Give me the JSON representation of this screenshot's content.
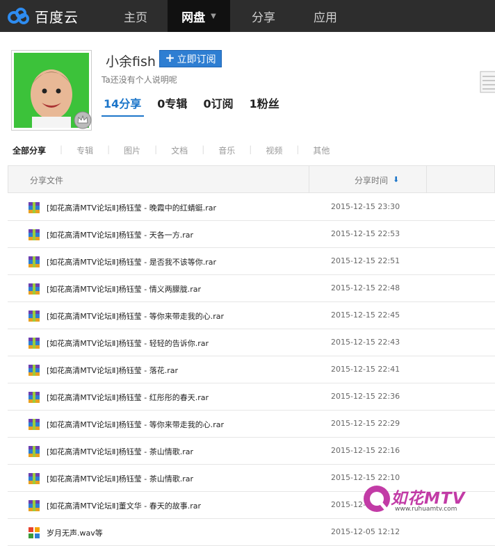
{
  "topbar": {
    "logo_text": "百度云",
    "nav": [
      {
        "label": "主页"
      },
      {
        "label": "网盘"
      },
      {
        "label": "分享"
      },
      {
        "label": "应用"
      }
    ]
  },
  "profile": {
    "username": "小余fish",
    "subscribe_label": "立即订阅",
    "bio": "Ta还没有个人说明呢",
    "stats": [
      {
        "count": "14",
        "label": "分享"
      },
      {
        "count": "0",
        "label": "专辑"
      },
      {
        "count": "0",
        "label": "订阅"
      },
      {
        "count": "1",
        "label": "粉丝"
      }
    ]
  },
  "filters": [
    "全部分享",
    "专辑",
    "图片",
    "文档",
    "音乐",
    "视频",
    "其他"
  ],
  "table": {
    "col_file": "分享文件",
    "col_time": "分享时间",
    "rows": [
      {
        "name": "[如花高清MTV论坛Ⅱ]杨钰莹 - 晚霞中的红蜻蜓.rar",
        "time": "2015-12-15 23:30"
      },
      {
        "name": "[如花高清MTV论坛Ⅱ]杨钰莹 - 天各一方.rar",
        "time": "2015-12-15 22:53"
      },
      {
        "name": "[如花高清MTV论坛Ⅱ]杨钰莹 - 是否我不该等你.rar",
        "time": "2015-12-15 22:51"
      },
      {
        "name": "[如花高清MTV论坛Ⅱ]杨钰莹 - 情义两朦胧.rar",
        "time": "2015-12-15 22:48"
      },
      {
        "name": "[如花高清MTV论坛Ⅱ]杨钰莹 - 等你来带走我的心.rar",
        "time": "2015-12-15 22:45"
      },
      {
        "name": "[如花高清MTV论坛Ⅱ]杨钰莹 - 轻轻的告诉你.rar",
        "time": "2015-12-15 22:43"
      },
      {
        "name": "[如花高清MTV论坛Ⅱ]杨钰莹 - 落花.rar",
        "time": "2015-12-15 22:41"
      },
      {
        "name": "[如花高清MTV论坛Ⅱ]杨钰莹 - 红彤彤的春天.rar",
        "time": "2015-12-15 22:36"
      },
      {
        "name": "[如花高清MTV论坛Ⅱ]杨钰莹 - 等你来带走我的心.rar",
        "time": "2015-12-15 22:29"
      },
      {
        "name": "[如花高清MTV论坛Ⅱ]杨钰莹 - 茶山情歌.rar",
        "time": "2015-12-15 22:16"
      },
      {
        "name": "[如花高清MTV论坛Ⅱ]杨钰莹 - 茶山情歌.rar",
        "time": "2015-12-15 22:10"
      },
      {
        "name": "[如花高清MTV论坛Ⅱ]董文华 - 春天的故事.rar",
        "time": "2015-12-15"
      },
      {
        "name": "岁月无声.wav等",
        "time": "2015-12-05 12:12"
      }
    ]
  },
  "watermark": {
    "text": "如花MTV",
    "url": "www.ruhuamtv.com"
  },
  "colors": {
    "accent": "#1b75c9",
    "topbar": "#2d2d2d",
    "button": "#2e7ed2"
  }
}
